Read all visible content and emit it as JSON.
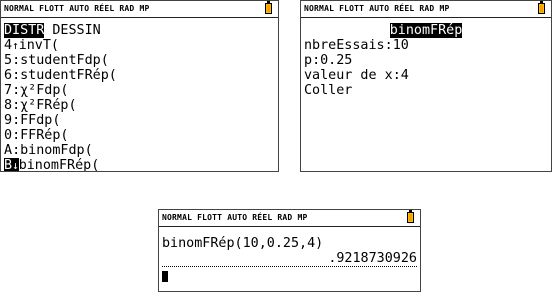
{
  "status_bar": "NORMAL FLOTT AUTO RÉEL RAD MP",
  "screen1": {
    "tabs": {
      "distr": "DISTR",
      "dessin": "DESSIN"
    },
    "items": [
      {
        "key": "4",
        "sep": "↑",
        "label": "invT("
      },
      {
        "key": "5",
        "sep": ":",
        "label": "studentFdp("
      },
      {
        "key": "6",
        "sep": ":",
        "label": "studentFRép("
      },
      {
        "key": "7",
        "sep": ":",
        "label": "χ²Fdp("
      },
      {
        "key": "8",
        "sep": ":",
        "label": "χ²FRép("
      },
      {
        "key": "9",
        "sep": ":",
        "label": "FFdp("
      },
      {
        "key": "0",
        "sep": ":",
        "label": "FFRép("
      },
      {
        "key": "A",
        "sep": ":",
        "label": "binomFdp("
      },
      {
        "key": "B",
        "sep": "↓",
        "label": "binomFRép("
      }
    ]
  },
  "screen2": {
    "title": "binomFRép",
    "fields": [
      {
        "label": "nbreEssais",
        "sep": ":",
        "value": "10"
      },
      {
        "label": "p",
        "sep": ":",
        "value": "0.25"
      },
      {
        "label": "valeur de x",
        "sep": ":",
        "value": "4"
      }
    ],
    "paste": "Coller"
  },
  "screen3": {
    "expression": "binomFRép(10,0.25,4)",
    "result": ".9218730926"
  }
}
